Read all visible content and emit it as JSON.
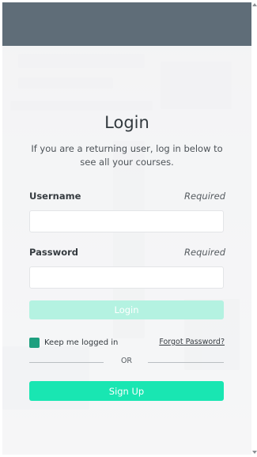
{
  "login": {
    "title": "Login",
    "subtitle": "If you are a returning user, log in below to see all your courses.",
    "username_label": "Username",
    "username_required": "Required",
    "username_value": "",
    "password_label": "Password",
    "password_required": "Required",
    "password_value": "",
    "login_button": "Login",
    "keep_logged_in": "Keep me logged in",
    "keep_logged_in_checked": true,
    "forgot_password": "Forgot Password?",
    "or_divider": "OR",
    "signup_button": "Sign Up"
  },
  "colors": {
    "header": "#5f6d78",
    "login_button_disabled": "#b4f2e1",
    "signup_button": "#19e6b2",
    "checkbox": "#1e9f7f"
  },
  "icons": {
    "scroll_up": "triangle-up",
    "scroll_down": "triangle-down"
  }
}
